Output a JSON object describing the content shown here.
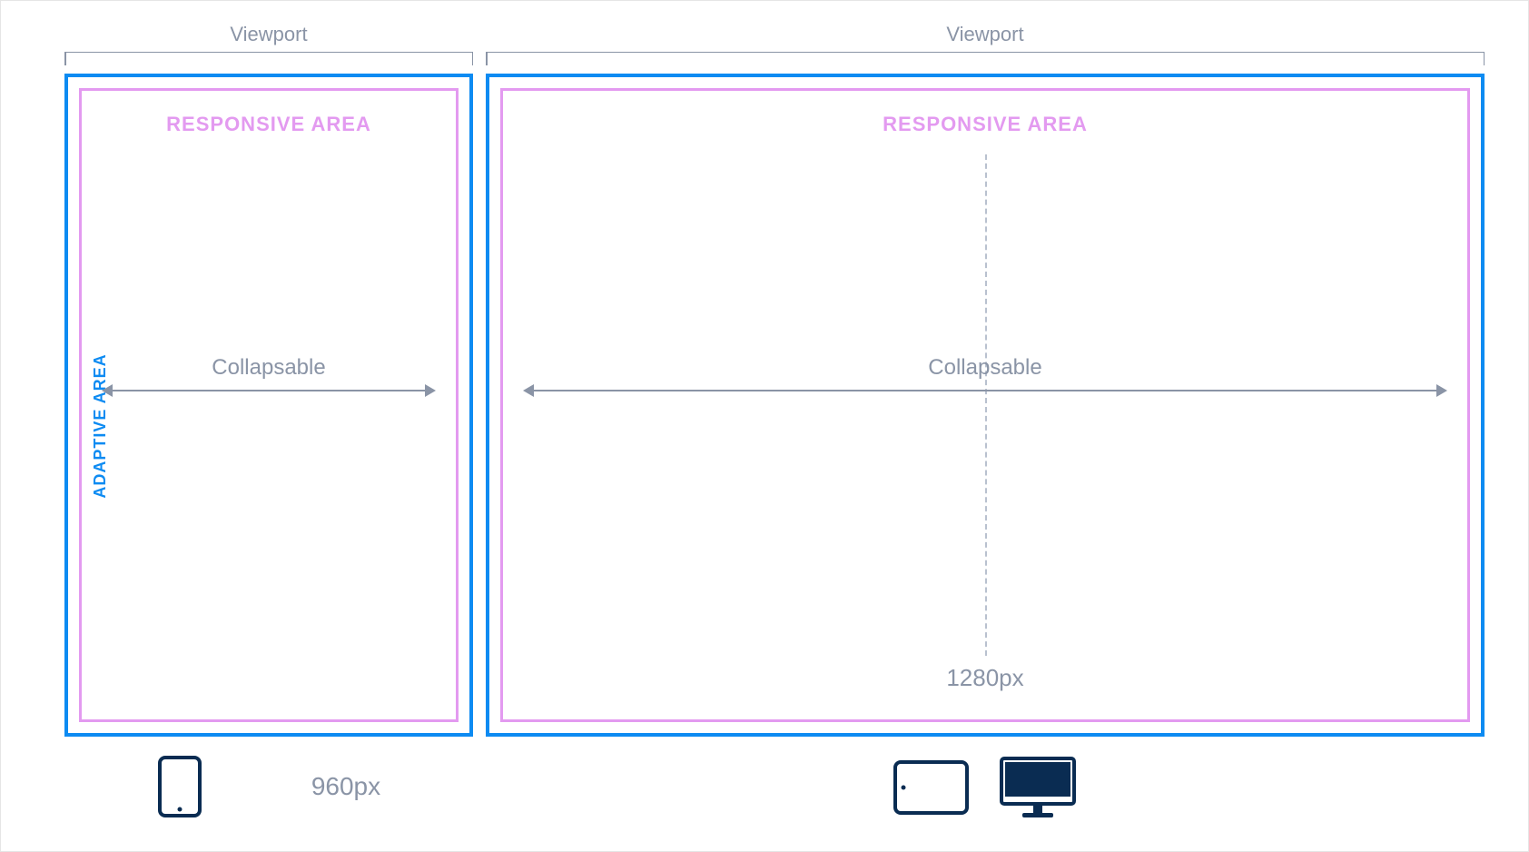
{
  "side_label": "ADAPTIVE AREA",
  "viewports": {
    "left": {
      "label": "Viewport"
    },
    "right": {
      "label": "Viewport"
    }
  },
  "boxes": {
    "small": {
      "responsive_title": "RESPONSIVE AREA",
      "collapsable_label": "Collapsable",
      "width_label": "960px"
    },
    "large": {
      "responsive_title": "RESPONSIVE AREA",
      "collapsable_label": "Collapsable",
      "center_width_label": "1280px"
    }
  }
}
